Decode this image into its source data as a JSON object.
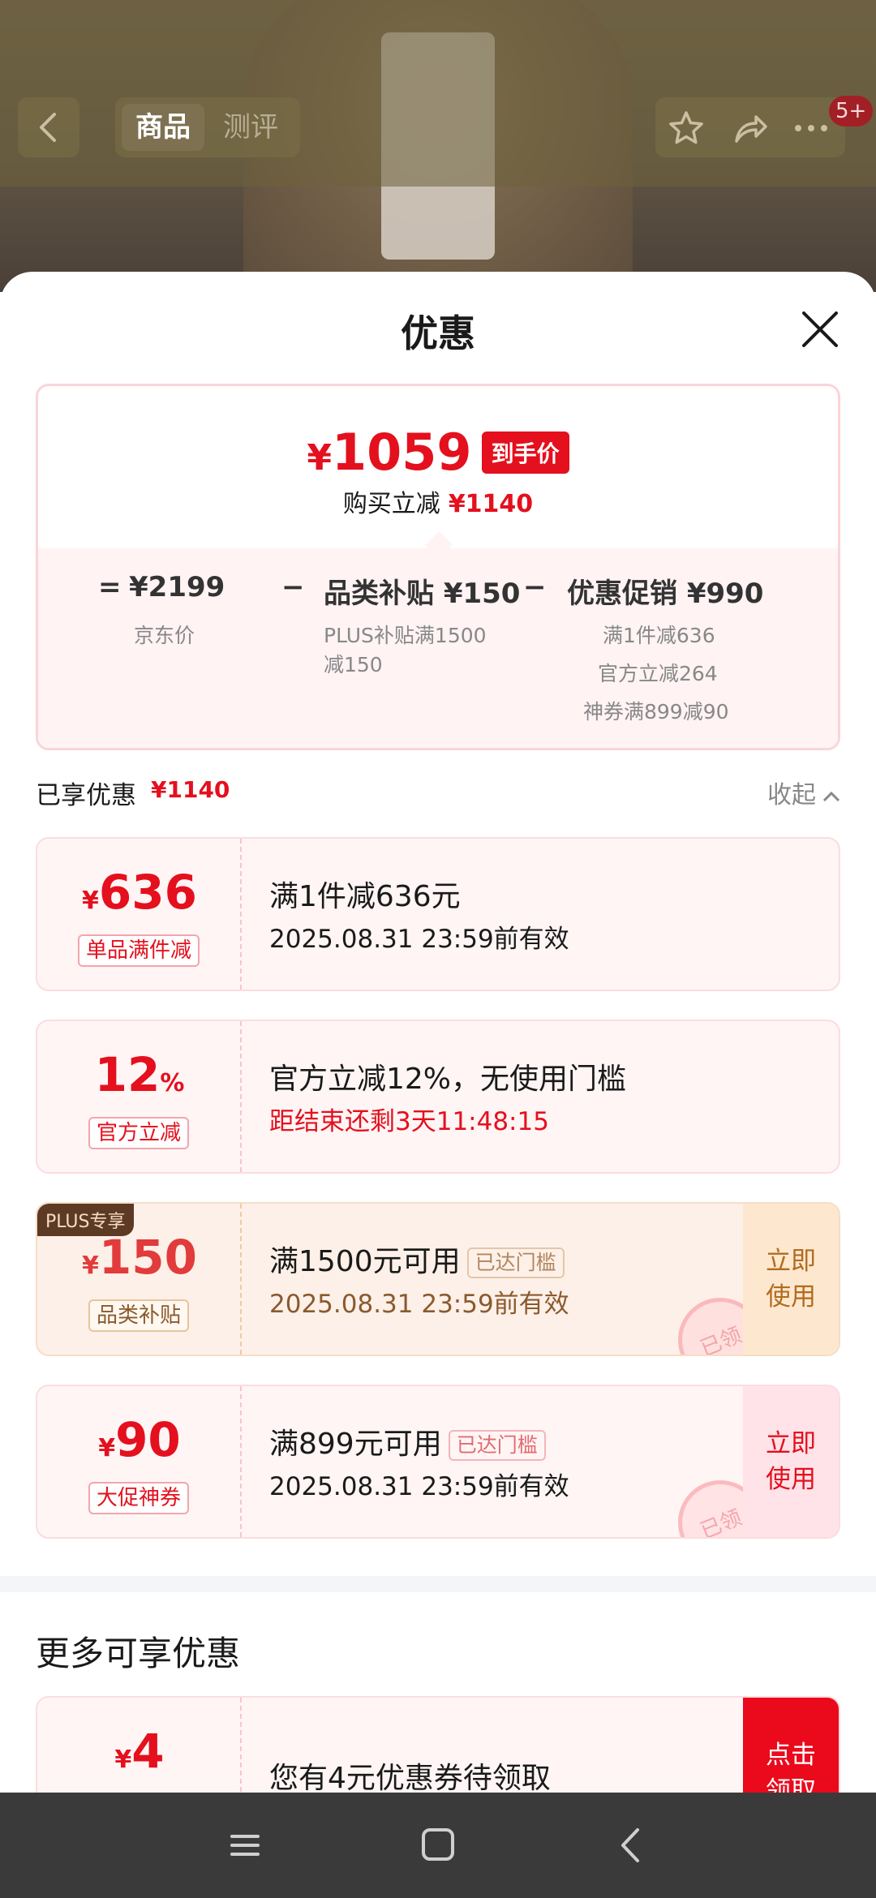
{
  "product_header": {
    "tabs": [
      "商品",
      "测评"
    ],
    "badge": "5+",
    "icons": [
      "back-icon",
      "star-icon",
      "share-icon",
      "more-icon"
    ]
  },
  "sheet": {
    "title": "优惠",
    "summary": {
      "final_price": "1059",
      "currency": "¥",
      "final_tag": "到手价",
      "cut_label": "购买立减",
      "cut_value": "¥1140",
      "equals": "=",
      "minus1": "−",
      "minus2": "−",
      "base_price": "¥2199",
      "base_label": "京东价",
      "subsidy": "品类补贴 ¥150",
      "subsidy_detail_1": "PLUS补贴满1500",
      "subsidy_detail_2": "减150",
      "promo": "优惠促销 ¥990",
      "promo_details": [
        "满1件减636",
        "官方立减264",
        "神券满899减90"
      ]
    },
    "enjoyed": {
      "label": "已享优惠",
      "value": "¥1140",
      "collapse": "收起"
    },
    "coupons": [
      {
        "yen": "¥",
        "amount": "636",
        "tag": "单品满件减",
        "title": "满1件减636元",
        "sub": "2025.08.31 23:59前有效"
      },
      {
        "amount": "12",
        "pct": "%",
        "tag": "官方立减",
        "title": "官方立减12%，无使用门槛",
        "sub": "距结束还剩3天11:48:15"
      },
      {
        "plus": "PLUS专享",
        "yen": "¥",
        "amount": "150",
        "tag": "品类补贴",
        "title": "满1500元可用",
        "reached": "已达门槛",
        "sub": "2025.08.31 23:59前有效",
        "button": [
          "立即",
          "使用"
        ],
        "stamp": "已领"
      },
      {
        "yen": "¥",
        "amount": "90",
        "tag": "大促神券",
        "title": "满899元可用",
        "reached": "已达门槛",
        "sub": "2025.08.31 23:59前有效",
        "button": [
          "立即",
          "使用"
        ],
        "stamp": "已领"
      }
    ],
    "more": {
      "title": "更多可享优惠",
      "coupon": {
        "yen": "¥",
        "amount": "4",
        "title": "您有4元优惠券待领取",
        "button": [
          "点击",
          "领取"
        ]
      }
    }
  },
  "navbar": {
    "icons": [
      "menu-icon",
      "home-icon",
      "back-nav-icon"
    ]
  },
  "colors": {
    "accent_red": "#e4101e",
    "plus_brown": "#5d3a24",
    "gold": "#b26b1f"
  }
}
